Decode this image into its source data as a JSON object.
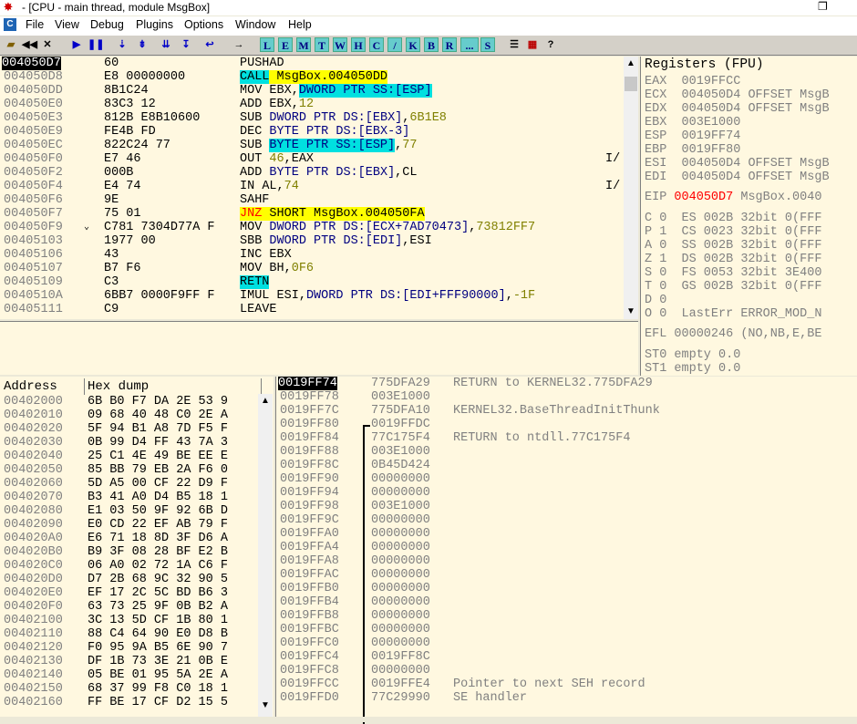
{
  "window": {
    "title": "- [CPU - main thread, module MsgBox]"
  },
  "menu": [
    "File",
    "View",
    "Debug",
    "Plugins",
    "Options",
    "Window",
    "Help"
  ],
  "toolbar": {
    "icons": [
      "open-icon",
      "rewind-icon",
      "close-icon",
      "run-icon",
      "pause-icon",
      "step-into-icon",
      "step-over-icon",
      "trace-into-icon",
      "trace-over-icon",
      "execute-till-return-icon",
      "goto-icon"
    ],
    "letters": [
      "L",
      "E",
      "M",
      "T",
      "W",
      "H",
      "C",
      "/",
      "K",
      "B",
      "R",
      "...",
      "S"
    ]
  },
  "cpu": {
    "rows": [
      {
        "addr": "004050D7",
        "hex": "60",
        "dis": "PUSHAD",
        "cmt": ""
      },
      {
        "addr": "004050D8",
        "hex": "E8 00000000",
        "dis": "CALL MsgBox.004050DD",
        "cmt": ""
      },
      {
        "addr": "004050DD",
        "hex": "8B1C24",
        "dis": "MOV EBX,DWORD PTR SS:[ESP]",
        "cmt": ""
      },
      {
        "addr": "004050E0",
        "hex": "83C3 12",
        "dis": "ADD EBX,12",
        "cmt": ""
      },
      {
        "addr": "004050E3",
        "hex": "812B E8B10600",
        "dis": "SUB DWORD PTR DS:[EBX],6B1E8",
        "cmt": ""
      },
      {
        "addr": "004050E9",
        "hex": "FE4B FD",
        "dis": "DEC BYTE PTR DS:[EBX-3]",
        "cmt": ""
      },
      {
        "addr": "004050EC",
        "hex": "822C24 77",
        "dis": "SUB BYTE PTR SS:[ESP],77",
        "cmt": ""
      },
      {
        "addr": "004050F0",
        "hex": "E7 46",
        "dis": "OUT 46,EAX",
        "cmt": "I/"
      },
      {
        "addr": "004050F2",
        "hex": "000B",
        "dis": "ADD BYTE PTR DS:[EBX],CL",
        "cmt": ""
      },
      {
        "addr": "004050F4",
        "hex": "E4 74",
        "dis": "IN AL,74",
        "cmt": "I/"
      },
      {
        "addr": "004050F6",
        "hex": "9E",
        "dis": "SAHF",
        "cmt": ""
      },
      {
        "addr": "004050F7",
        "hex": "75 01",
        "dis": "JNZ SHORT MsgBox.004050FA",
        "cmt": ""
      },
      {
        "addr": "004050F9",
        "hex": "C781 7304D77A F",
        "dis": "MOV DWORD PTR DS:[ECX+7AD70473],73812FF7",
        "cmt": ""
      },
      {
        "addr": "00405103",
        "hex": "1977 00",
        "dis": "SBB DWORD PTR DS:[EDI],ESI",
        "cmt": ""
      },
      {
        "addr": "00405106",
        "hex": "43",
        "dis": "INC EBX",
        "cmt": ""
      },
      {
        "addr": "00405107",
        "hex": "B7 F6",
        "dis": "MOV BH,0F6",
        "cmt": ""
      },
      {
        "addr": "00405109",
        "hex": "C3",
        "dis": "RETN",
        "cmt": ""
      },
      {
        "addr": "0040510A",
        "hex": "6BB7 0000F9FF F",
        "dis": "IMUL ESI,DWORD PTR DS:[EDI+FFF90000],-1F",
        "cmt": ""
      },
      {
        "addr": "00405111",
        "hex": "C9",
        "dis": "LEAVE",
        "cmt": ""
      }
    ]
  },
  "registers": {
    "header": "Registers (FPU)",
    "gp": [
      {
        "name": "EAX",
        "val": "0019FFCC",
        "cmt": ""
      },
      {
        "name": "ECX",
        "val": "004050D4",
        "cmt": "OFFSET MsgB"
      },
      {
        "name": "EDX",
        "val": "004050D4",
        "cmt": "OFFSET MsgB"
      },
      {
        "name": "EBX",
        "val": "003E1000",
        "cmt": ""
      },
      {
        "name": "ESP",
        "val": "0019FF74",
        "cmt": ""
      },
      {
        "name": "EBP",
        "val": "0019FF80",
        "cmt": ""
      },
      {
        "name": "ESI",
        "val": "004050D4",
        "cmt": "OFFSET MsgB"
      },
      {
        "name": "EDI",
        "val": "004050D4",
        "cmt": "OFFSET MsgB"
      }
    ],
    "eip": {
      "name": "EIP",
      "val": "004050D7",
      "cmt": "MsgBox.0040"
    },
    "flags": [
      "C 0  ES 002B 32bit 0(FFF",
      "P 1  CS 0023 32bit 0(FFF",
      "A 0  SS 002B 32bit 0(FFF",
      "Z 1  DS 002B 32bit 0(FFF",
      "S 0  FS 0053 32bit 3E400",
      "T 0  GS 002B 32bit 0(FFF",
      "D 0",
      "O 0  LastErr ERROR_MOD_N"
    ],
    "efl": "EFL 00000246 (NO,NB,E,BE",
    "fpu": [
      "ST0 empty 0.0",
      "ST1 empty 0.0"
    ]
  },
  "dump": {
    "col_address": "Address",
    "col_hex": "Hex dump",
    "rows": [
      {
        "addr": "00402000",
        "hex": "6B B0 F7 DA 2E 53 9"
      },
      {
        "addr": "00402010",
        "hex": "09 68 40 48 C0 2E A"
      },
      {
        "addr": "00402020",
        "hex": "5F 94 B1 A8 7D F5 F"
      },
      {
        "addr": "00402030",
        "hex": "0B 99 D4 FF 43 7A 3"
      },
      {
        "addr": "00402040",
        "hex": "25 C1 4E 49 BE EE E"
      },
      {
        "addr": "00402050",
        "hex": "85 BB 79 EB 2A F6 0"
      },
      {
        "addr": "00402060",
        "hex": "5D A5 00 CF 22 D9 F"
      },
      {
        "addr": "00402070",
        "hex": "B3 41 A0 D4 B5 18 1"
      },
      {
        "addr": "00402080",
        "hex": "E1 03 50 9F 92 6B D"
      },
      {
        "addr": "00402090",
        "hex": "E0 CD 22 EF AB 79 F"
      },
      {
        "addr": "004020A0",
        "hex": "E6 71 18 8D 3F D6 A"
      },
      {
        "addr": "004020B0",
        "hex": "B9 3F 08 28 BF E2 B"
      },
      {
        "addr": "004020C0",
        "hex": "06 A0 02 72 1A C6 F"
      },
      {
        "addr": "004020D0",
        "hex": "D7 2B 68 9C 32 90 5"
      },
      {
        "addr": "004020E0",
        "hex": "EF 17 2C 5C BD B6 3"
      },
      {
        "addr": "004020F0",
        "hex": "63 73 25 9F 0B B2 A"
      },
      {
        "addr": "00402100",
        "hex": "3C 13 5D CF 1B 80 1"
      },
      {
        "addr": "00402110",
        "hex": "88 C4 64 90 E0 D8 B"
      },
      {
        "addr": "00402120",
        "hex": "F0 95 9A B5 6E 90 7"
      },
      {
        "addr": "00402130",
        "hex": "DF 1B 73 3E 21 0B E"
      },
      {
        "addr": "00402140",
        "hex": "05 BE 01 95 5A 2E A"
      },
      {
        "addr": "00402150",
        "hex": "68 37 99 F8 C0 18 1"
      },
      {
        "addr": "00402160",
        "hex": "FF BE 17 CF D2 15 5"
      }
    ]
  },
  "stack": {
    "rows": [
      {
        "addr": "0019FF74",
        "val": "775DFA29",
        "cmt": "RETURN to KERNEL32.775DFA29"
      },
      {
        "addr": "0019FF78",
        "val": "003E1000",
        "cmt": ""
      },
      {
        "addr": "0019FF7C",
        "val": "775DFA10",
        "cmt": "KERNEL32.BaseThreadInitThunk"
      },
      {
        "addr": "0019FF80",
        "val": "0019FFDC",
        "cmt": ""
      },
      {
        "addr": "0019FF84",
        "val": "77C175F4",
        "cmt": "RETURN to ntdll.77C175F4"
      },
      {
        "addr": "0019FF88",
        "val": "003E1000",
        "cmt": ""
      },
      {
        "addr": "0019FF8C",
        "val": "0B45D424",
        "cmt": ""
      },
      {
        "addr": "0019FF90",
        "val": "00000000",
        "cmt": ""
      },
      {
        "addr": "0019FF94",
        "val": "00000000",
        "cmt": ""
      },
      {
        "addr": "0019FF98",
        "val": "003E1000",
        "cmt": ""
      },
      {
        "addr": "0019FF9C",
        "val": "00000000",
        "cmt": ""
      },
      {
        "addr": "0019FFA0",
        "val": "00000000",
        "cmt": ""
      },
      {
        "addr": "0019FFA4",
        "val": "00000000",
        "cmt": ""
      },
      {
        "addr": "0019FFA8",
        "val": "00000000",
        "cmt": ""
      },
      {
        "addr": "0019FFAC",
        "val": "00000000",
        "cmt": ""
      },
      {
        "addr": "0019FFB0",
        "val": "00000000",
        "cmt": ""
      },
      {
        "addr": "0019FFB4",
        "val": "00000000",
        "cmt": ""
      },
      {
        "addr": "0019FFB8",
        "val": "00000000",
        "cmt": ""
      },
      {
        "addr": "0019FFBC",
        "val": "00000000",
        "cmt": ""
      },
      {
        "addr": "0019FFC0",
        "val": "00000000",
        "cmt": ""
      },
      {
        "addr": "0019FFC4",
        "val": "0019FF8C",
        "cmt": ""
      },
      {
        "addr": "0019FFC8",
        "val": "00000000",
        "cmt": ""
      },
      {
        "addr": "0019FFCC",
        "val": "0019FFE4",
        "cmt": "Pointer to next SEH record"
      },
      {
        "addr": "0019FFD0",
        "val": "77C29990",
        "cmt": "SE handler"
      }
    ]
  },
  "colors": {
    "pane_bg": "#fff8e0",
    "highlight_cyan": "#00e0e0",
    "highlight_yellow": "#ffff00",
    "eip_red": "#ff0000"
  }
}
